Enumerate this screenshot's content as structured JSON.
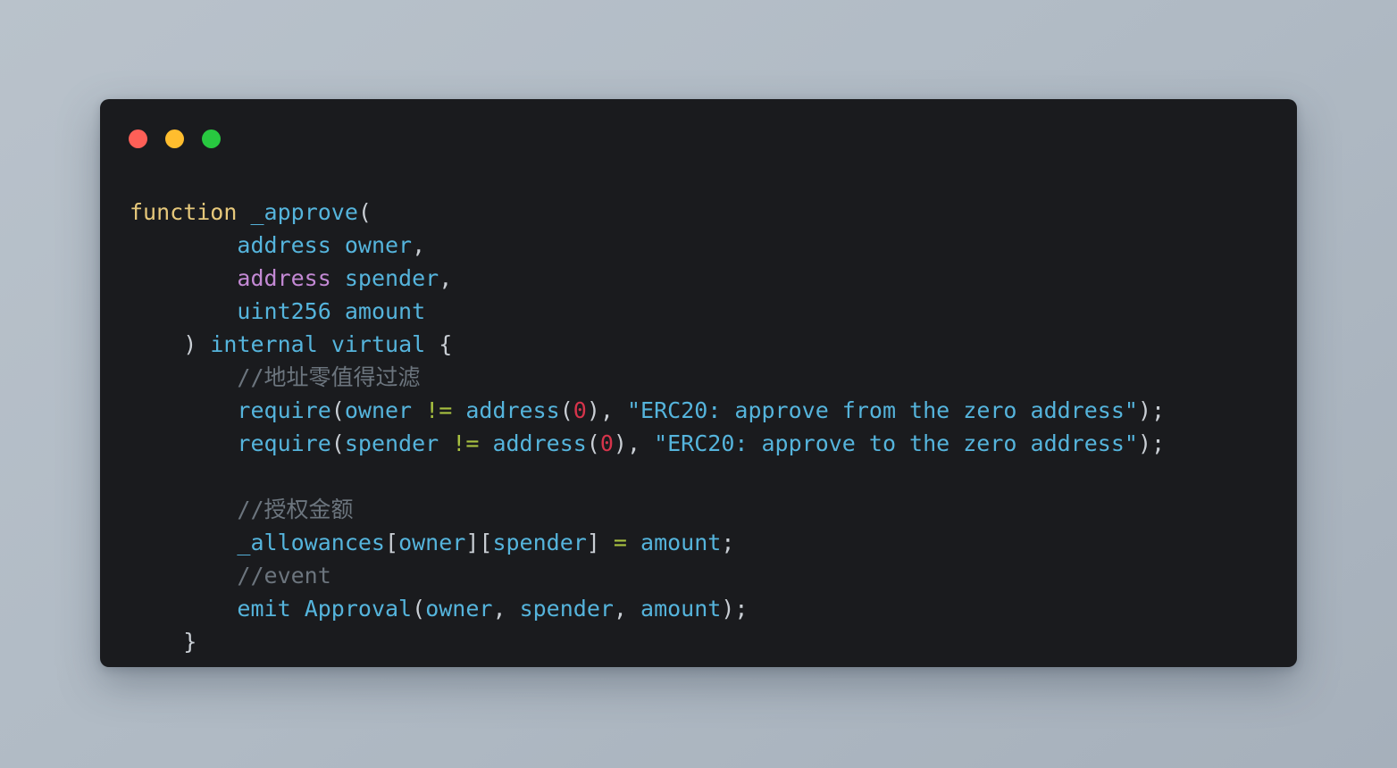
{
  "window": {
    "dots": [
      {
        "name": "close",
        "color": "#ff5f57"
      },
      {
        "name": "minimize",
        "color": "#ffbd2e"
      },
      {
        "name": "maximize",
        "color": "#28c840"
      }
    ]
  },
  "theme": {
    "page_background": "#b1bbc5",
    "card_background": "#1a1b1e",
    "keyword": "#e6c87b",
    "identifier": "#55b4dc",
    "type_purple": "#c389d4",
    "punctuation": "#c9ced4",
    "operator": "#a8c140",
    "number": "#d6344b",
    "comment": "#6c757e"
  },
  "code": {
    "language": "solidity",
    "plain_text": "function _approve(\n        address owner,\n        address spender,\n        uint256 amount\n    ) internal virtual {\n        //地址零值得过滤\n        require(owner != address(0), \"ERC20: approve from the zero address\");\n        require(spender != address(0), \"ERC20: approve to the zero address\");\n\n        //授权金额\n        _allowances[owner][spender] = amount;\n        //event\n        emit Approval(owner, spender, amount);\n    }",
    "lines": [
      {
        "indent": 0,
        "tokens": [
          {
            "t": "function",
            "c": "t-kw"
          },
          {
            "t": " ",
            "c": "t-punc"
          },
          {
            "t": "_approve",
            "c": "t-id"
          },
          {
            "t": "(",
            "c": "t-punc"
          }
        ]
      },
      {
        "indent": 8,
        "tokens": [
          {
            "t": "address",
            "c": "t-type"
          },
          {
            "t": " ",
            "c": "t-punc"
          },
          {
            "t": "owner",
            "c": "t-id"
          },
          {
            "t": ",",
            "c": "t-punc"
          }
        ]
      },
      {
        "indent": 8,
        "tokens": [
          {
            "t": "address",
            "c": "t-purple"
          },
          {
            "t": " ",
            "c": "t-punc"
          },
          {
            "t": "spender",
            "c": "t-id"
          },
          {
            "t": ",",
            "c": "t-punc"
          }
        ]
      },
      {
        "indent": 8,
        "tokens": [
          {
            "t": "uint256",
            "c": "t-type"
          },
          {
            "t": " ",
            "c": "t-punc"
          },
          {
            "t": "amount",
            "c": "t-id"
          }
        ]
      },
      {
        "indent": 4,
        "tokens": [
          {
            "t": ")",
            "c": "t-punc"
          },
          {
            "t": " ",
            "c": "t-punc"
          },
          {
            "t": "internal",
            "c": "t-id"
          },
          {
            "t": " ",
            "c": "t-punc"
          },
          {
            "t": "virtual",
            "c": "t-id"
          },
          {
            "t": " ",
            "c": "t-punc"
          },
          {
            "t": "{",
            "c": "t-punc"
          }
        ]
      },
      {
        "indent": 8,
        "tokens": [
          {
            "t": "//地址零值得过滤",
            "c": "t-cmt"
          }
        ]
      },
      {
        "indent": 8,
        "tokens": [
          {
            "t": "require",
            "c": "t-id"
          },
          {
            "t": "(",
            "c": "t-punc"
          },
          {
            "t": "owner",
            "c": "t-id"
          },
          {
            "t": " ",
            "c": "t-punc"
          },
          {
            "t": "!=",
            "c": "t-op"
          },
          {
            "t": " ",
            "c": "t-punc"
          },
          {
            "t": "address",
            "c": "t-id"
          },
          {
            "t": "(",
            "c": "t-punc"
          },
          {
            "t": "0",
            "c": "t-num"
          },
          {
            "t": "), ",
            "c": "t-punc"
          },
          {
            "t": "\"ERC20: approve from the zero address\"",
            "c": "t-str"
          },
          {
            "t": ");",
            "c": "t-punc"
          }
        ]
      },
      {
        "indent": 8,
        "tokens": [
          {
            "t": "require",
            "c": "t-id"
          },
          {
            "t": "(",
            "c": "t-punc"
          },
          {
            "t": "spender",
            "c": "t-id"
          },
          {
            "t": " ",
            "c": "t-punc"
          },
          {
            "t": "!=",
            "c": "t-op"
          },
          {
            "t": " ",
            "c": "t-punc"
          },
          {
            "t": "address",
            "c": "t-id"
          },
          {
            "t": "(",
            "c": "t-punc"
          },
          {
            "t": "0",
            "c": "t-num"
          },
          {
            "t": "), ",
            "c": "t-punc"
          },
          {
            "t": "\"ERC20: approve to the zero address\"",
            "c": "t-str"
          },
          {
            "t": ");",
            "c": "t-punc"
          }
        ]
      },
      {
        "indent": 0,
        "tokens": []
      },
      {
        "indent": 8,
        "tokens": [
          {
            "t": "//授权金额",
            "c": "t-cmt"
          }
        ]
      },
      {
        "indent": 8,
        "tokens": [
          {
            "t": "_allowances",
            "c": "t-id"
          },
          {
            "t": "[",
            "c": "t-punc"
          },
          {
            "t": "owner",
            "c": "t-id"
          },
          {
            "t": "][",
            "c": "t-punc"
          },
          {
            "t": "spender",
            "c": "t-id"
          },
          {
            "t": "] ",
            "c": "t-punc"
          },
          {
            "t": "=",
            "c": "t-op"
          },
          {
            "t": " ",
            "c": "t-punc"
          },
          {
            "t": "amount",
            "c": "t-id"
          },
          {
            "t": ";",
            "c": "t-punc"
          }
        ]
      },
      {
        "indent": 8,
        "tokens": [
          {
            "t": "//event",
            "c": "t-cmt"
          }
        ]
      },
      {
        "indent": 8,
        "tokens": [
          {
            "t": "emit",
            "c": "t-id"
          },
          {
            "t": " ",
            "c": "t-punc"
          },
          {
            "t": "Approval",
            "c": "t-id"
          },
          {
            "t": "(",
            "c": "t-punc"
          },
          {
            "t": "owner",
            "c": "t-id"
          },
          {
            "t": ", ",
            "c": "t-punc"
          },
          {
            "t": "spender",
            "c": "t-id"
          },
          {
            "t": ", ",
            "c": "t-punc"
          },
          {
            "t": "amount",
            "c": "t-id"
          },
          {
            "t": ");",
            "c": "t-punc"
          }
        ]
      },
      {
        "indent": 4,
        "tokens": [
          {
            "t": "}",
            "c": "t-punc"
          }
        ]
      }
    ]
  }
}
